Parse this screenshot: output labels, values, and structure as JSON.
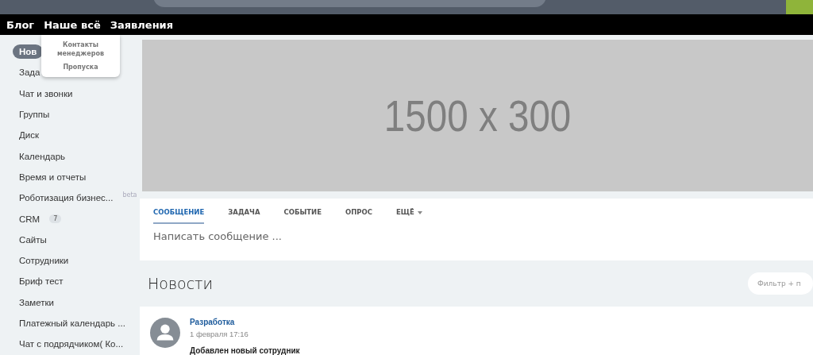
{
  "top_menu": [
    {
      "label": "Блог"
    },
    {
      "label": "Наше всё"
    },
    {
      "label": "Заявления"
    }
  ],
  "dropdown": {
    "items": [
      {
        "label": "Контакты менеджеров"
      },
      {
        "label": "Пропуска"
      }
    ]
  },
  "sidebar": {
    "items": [
      {
        "label": "Нов",
        "selected": true
      },
      {
        "label": "Зада",
        "selected": false
      },
      {
        "label": "Чат и звонки",
        "selected": false
      },
      {
        "label": "Группы",
        "selected": false
      },
      {
        "label": "Диск",
        "selected": false
      },
      {
        "label": "Календарь",
        "selected": false
      },
      {
        "label": "Время и отчеты",
        "selected": false
      },
      {
        "label": "Роботизация бизнес...",
        "selected": false,
        "badge": "beta"
      },
      {
        "label": "CRM",
        "selected": false,
        "counter": "7"
      },
      {
        "label": "Сайты",
        "selected": false
      },
      {
        "label": "Сотрудники",
        "selected": false
      },
      {
        "label": "Бриф тест",
        "selected": false
      },
      {
        "label": "Заметки",
        "selected": false
      },
      {
        "label": "Платежный календарь ...",
        "selected": false
      },
      {
        "label": "Чат с подрядчиком( Ко...",
        "selected": false
      }
    ]
  },
  "banner": {
    "text": "1500 x 300"
  },
  "composer": {
    "tabs": [
      {
        "label": "СООБЩЕНИЕ",
        "selected": true
      },
      {
        "label": "ЗАДАЧА",
        "selected": false
      },
      {
        "label": "СОБЫТИЕ",
        "selected": false
      },
      {
        "label": "ОПРОС",
        "selected": false
      },
      {
        "label": "ЕЩЁ",
        "selected": false,
        "dropdown": true
      }
    ],
    "placeholder": "Написать сообщение ..."
  },
  "feed": {
    "title": "Новости",
    "filter": {
      "placeholder": "Фильтр + п"
    },
    "posts": [
      {
        "author": "Разработка",
        "date": "1 февраля 17:16",
        "text": "Добавлен новый сотрудник"
      }
    ]
  }
}
